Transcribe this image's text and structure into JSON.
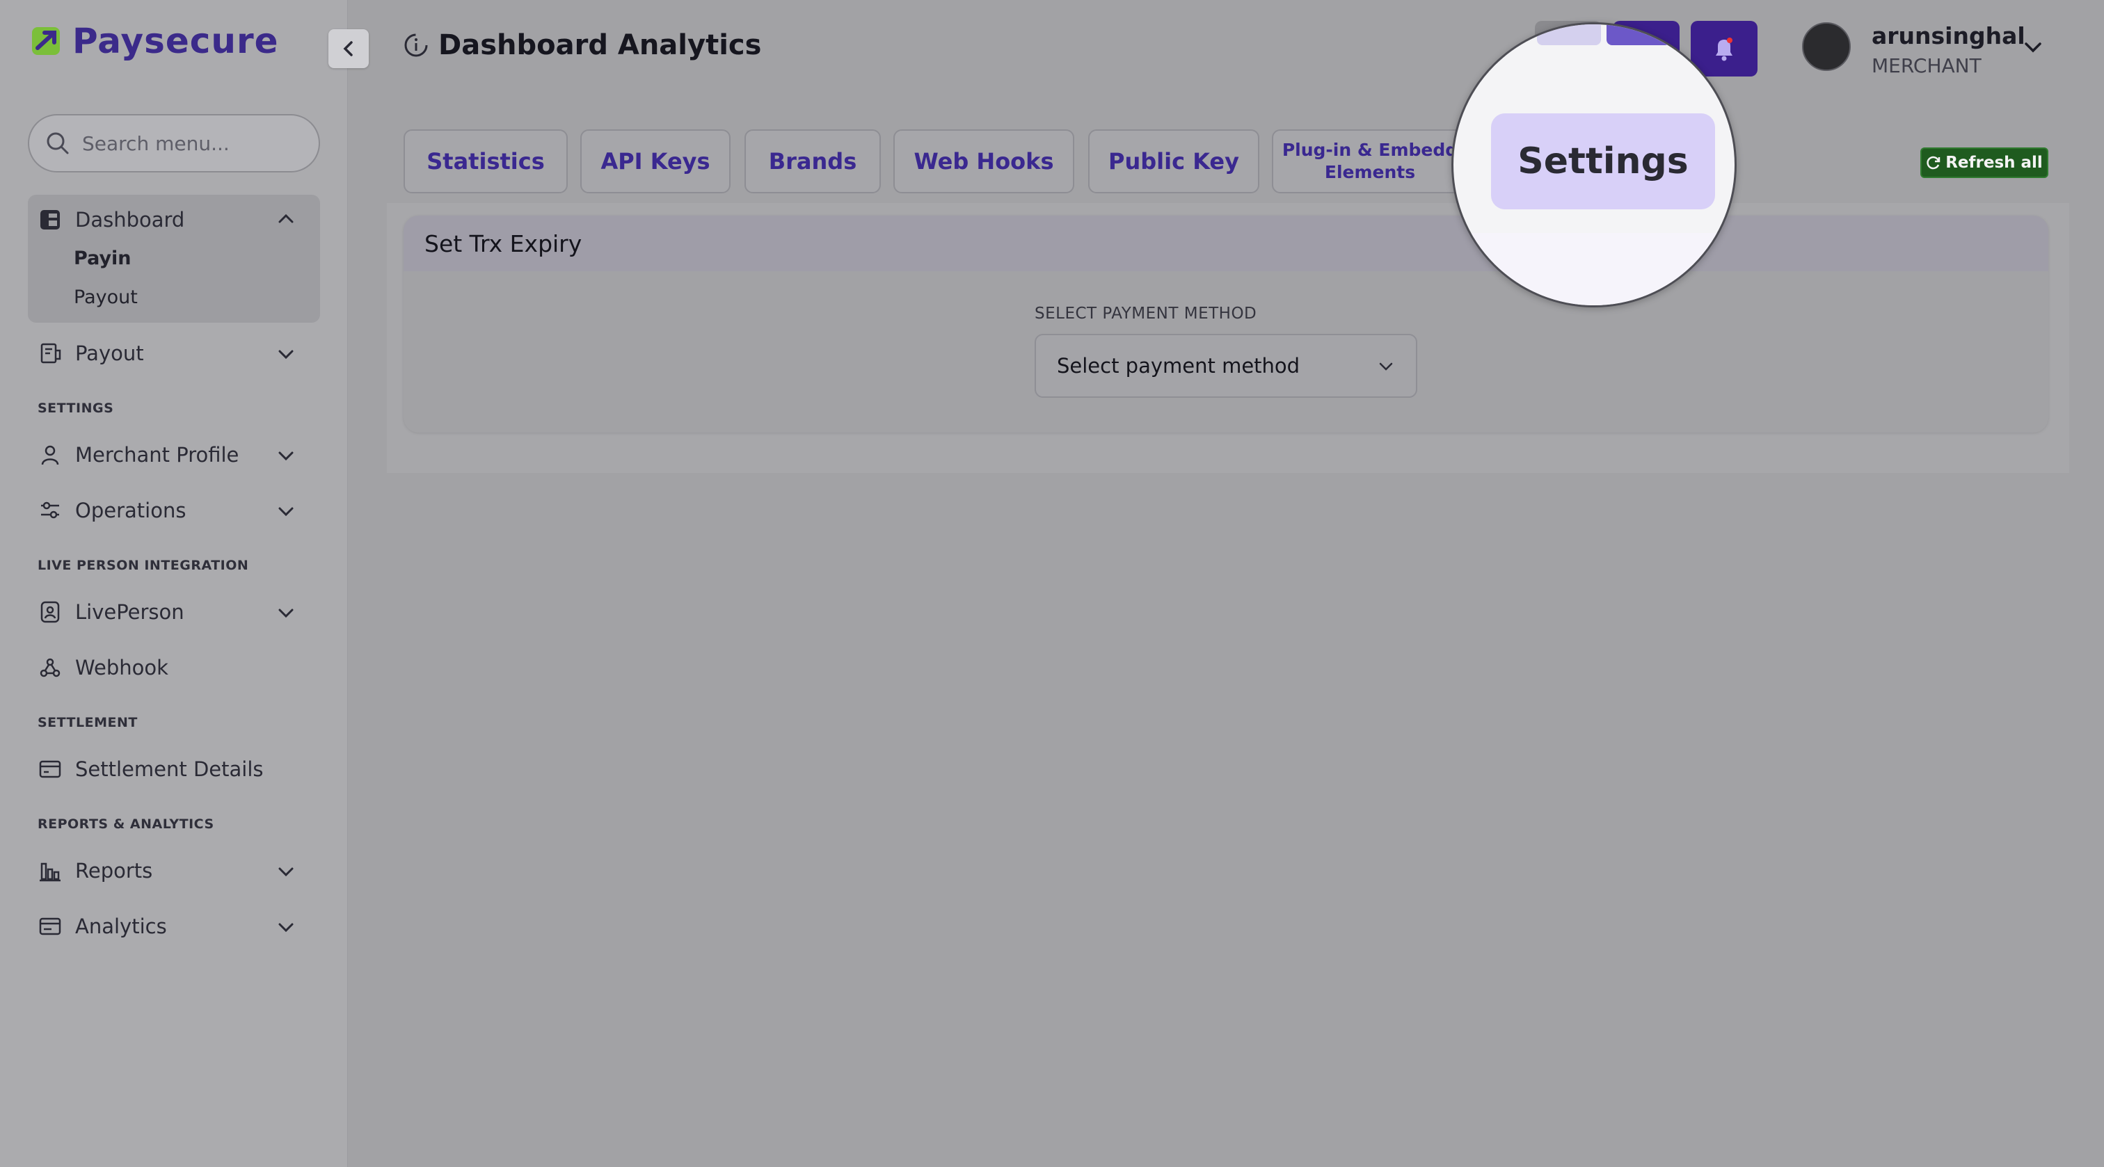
{
  "brand": {
    "name": "Paysecure",
    "accent": "#3b2a8a",
    "logo_green": "#7bbf3a"
  },
  "header": {
    "title": "Dashboard Analytics"
  },
  "search": {
    "placeholder": "Search menu..."
  },
  "sidebar": {
    "dashboard": {
      "label": "Dashboard",
      "children": [
        "Payin",
        "Payout"
      ]
    },
    "payout": {
      "label": "Payout"
    },
    "section_settings": "SETTINGS",
    "merchant_profile": {
      "label": "Merchant Profile"
    },
    "operations": {
      "label": "Operations"
    },
    "section_liveperson": "LIVE PERSON INTEGRATION",
    "liveperson": {
      "label": "LivePerson"
    },
    "webhook": {
      "label": "Webhook"
    },
    "section_settlement": "SETTLEMENT",
    "settlement_details": {
      "label": "Settlement Details"
    },
    "section_reports": "REPORTS & ANALYTICS",
    "reports": {
      "label": "Reports"
    },
    "analytics": {
      "label": "Analytics"
    }
  },
  "user": {
    "name": "arunsinghal",
    "role": "MERCHANT"
  },
  "tabs": {
    "statistics": "Statistics",
    "api_keys": "API Keys",
    "brands": "Brands",
    "web_hooks": "Web Hooks",
    "public_key": "Public Key",
    "plugin_line1": "Plug-in & Embedd",
    "plugin_line2": "Elements",
    "settings": "Settings"
  },
  "refresh_label": "Refresh all",
  "card": {
    "title": "Set Trx Expiry",
    "field_label": "SELECT PAYMENT METHOD",
    "select_value": "Select payment method"
  },
  "colors": {
    "purple_button": "#3b1f8c",
    "refresh_green": "#1f5b1f",
    "settings_highlight": "#d8d0f8"
  }
}
